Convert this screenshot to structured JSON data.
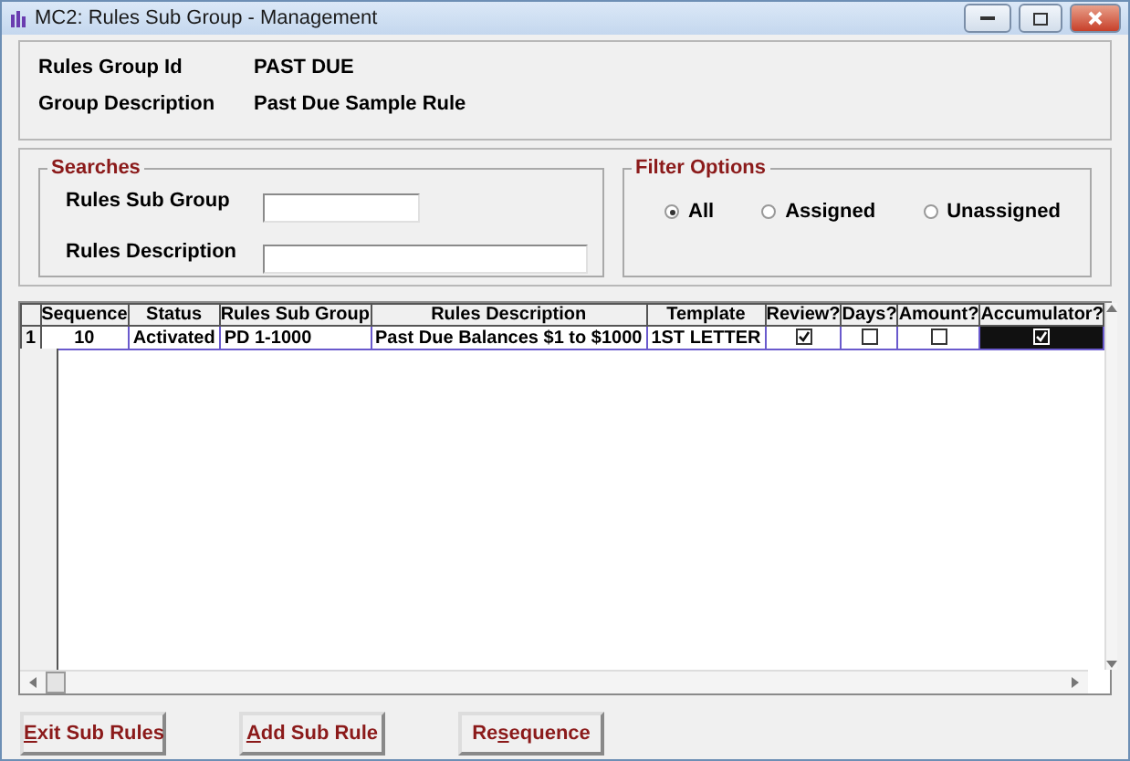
{
  "window": {
    "title": "MC2: Rules Sub Group - Management"
  },
  "header": [
    {
      "label": "Rules Group Id",
      "value": "PAST DUE"
    },
    {
      "label": "Group Description",
      "value": "Past Due Sample Rule"
    }
  ],
  "searches": {
    "title": "Searches",
    "fields": [
      {
        "label": "Rules Sub Group",
        "kind": "short"
      },
      {
        "label": "Rules Description",
        "kind": "long"
      }
    ]
  },
  "filter_options": {
    "title": "Filter Options",
    "options": [
      {
        "label": "All",
        "selected": true
      },
      {
        "label": "Assigned",
        "selected": false
      },
      {
        "label": "Unassigned",
        "selected": false
      }
    ]
  },
  "table": {
    "columns": [
      "Sequence",
      "Status",
      "Rules Sub Group",
      "Rules Description",
      "Template",
      "Review?",
      "Days?",
      "Amount?",
      "Accumulator?"
    ],
    "rows": [
      {
        "number": "1",
        "selected": true,
        "sequence": "10",
        "status": "Activated",
        "sub_group": "PD 1-1000",
        "description": "Past Due Balances $1 to $1000",
        "template": "1ST LETTER",
        "flags": [
          {
            "checked": true,
            "focused": false
          },
          {
            "checked": false,
            "focused": false
          },
          {
            "checked": false,
            "focused": false
          },
          {
            "checked": true,
            "focused": true
          }
        ]
      }
    ]
  },
  "buttons": [
    {
      "mnemonic": "E",
      "after": "xit Sub Rules"
    },
    {
      "mnemonic": "A",
      "after": "dd Sub Rule"
    },
    {
      "before": "Re",
      "mnemonic": "s",
      "after": "equence"
    }
  ]
}
